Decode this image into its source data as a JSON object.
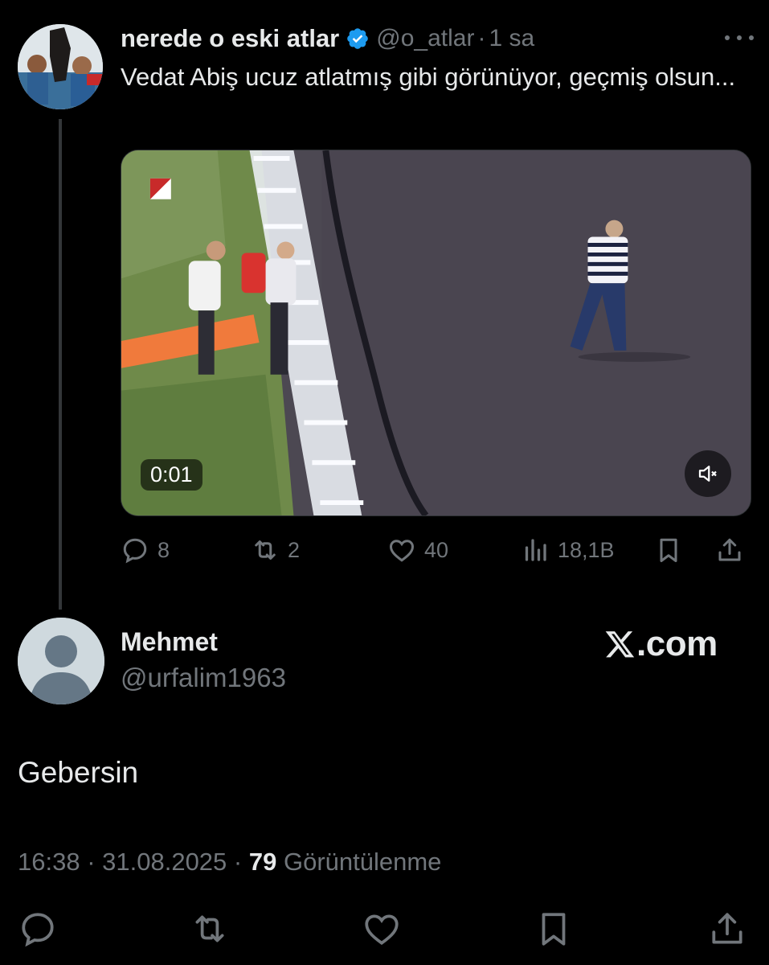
{
  "tweet": {
    "author_name": "nerede o eski atlar",
    "handle": "@o_atlar",
    "separator": "·",
    "time": "1 sa",
    "text": "Vedat Abiş ucuz atlatmış gibi görünüyor, geçmiş olsun...",
    "video": {
      "timestamp": "0:01"
    },
    "stats": {
      "replies": "8",
      "reposts": "2",
      "likes": "40",
      "views": "18,1B"
    }
  },
  "reply": {
    "name": "Mehmet",
    "handle": "@urfalim1963",
    "text": "Gebersin",
    "time": "16:38",
    "date": "31.08.2025",
    "views_count": "79",
    "views_label": "Görüntülenme",
    "sep": " · "
  },
  "brand": {
    "label": ".com"
  },
  "icons": [
    "verified-badge-icon",
    "more-icon",
    "reply-icon",
    "repost-icon",
    "like-icon",
    "views-icon",
    "bookmark-icon",
    "share-icon",
    "mute-icon",
    "x-logo-icon",
    "default-avatar-icon"
  ],
  "colors": {
    "background": "#000000",
    "text": "#e7e9ea",
    "muted": "#71767b",
    "verified": "#1d9bf0"
  }
}
